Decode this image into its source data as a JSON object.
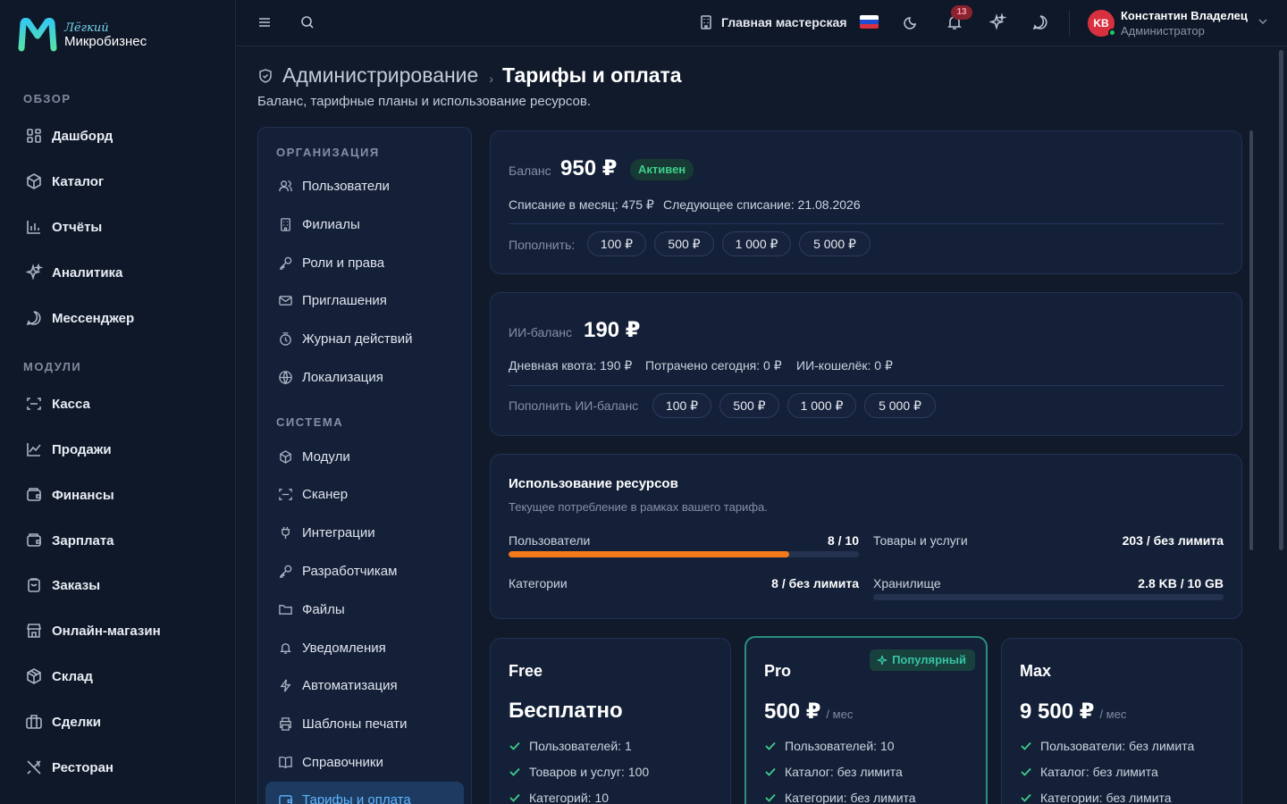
{
  "brand": {
    "small": "Лёгкий",
    "big": "Микробизнес",
    "colors": {
      "top": "#35c9f0",
      "bottom": "#56e0a8"
    }
  },
  "sidebar": {
    "sections": [
      {
        "title": "ОБЗОР",
        "items": [
          {
            "label": "Дашборд",
            "icon": "grid-icon"
          },
          {
            "label": "Каталог",
            "icon": "box-icon"
          },
          {
            "label": "Отчёты",
            "icon": "bar-chart-icon"
          },
          {
            "label": "Аналитика",
            "icon": "sparkle-icon"
          },
          {
            "label": "Мессенджер",
            "icon": "chat-icon"
          }
        ]
      },
      {
        "title": "МОДУЛИ",
        "items": [
          {
            "label": "Касса",
            "icon": "scan-icon"
          },
          {
            "label": "Продажи",
            "icon": "line-chart-icon"
          },
          {
            "label": "Финансы",
            "icon": "wallet-icon"
          },
          {
            "label": "Зарплата",
            "icon": "wallet-icon"
          },
          {
            "label": "Заказы",
            "icon": "clipboard-icon"
          },
          {
            "label": "Онлайн-магазин",
            "icon": "store-icon"
          },
          {
            "label": "Склад",
            "icon": "package-icon"
          },
          {
            "label": "Сделки",
            "icon": "briefcase-icon"
          },
          {
            "label": "Ресторан",
            "icon": "utensils-icon"
          }
        ]
      }
    ]
  },
  "header": {
    "workshop": "Главная мастерская",
    "notifications_count": "13",
    "user": {
      "initials": "KB",
      "name": "Константин Владелец",
      "role": "Администратор"
    }
  },
  "page": {
    "crumb_parent": "Администрирование",
    "crumb_separator": "›",
    "crumb_current": "Тарифы и оплата",
    "subtitle": "Баланс, тарифные планы и использование ресурсов."
  },
  "subnav": {
    "sections": [
      {
        "title": "ОРГАНИЗАЦИЯ",
        "items": [
          {
            "label": "Пользователи",
            "icon": "users-icon"
          },
          {
            "label": "Филиалы",
            "icon": "building-icon"
          },
          {
            "label": "Роли и права",
            "icon": "key-icon"
          },
          {
            "label": "Приглашения",
            "icon": "mail-icon"
          },
          {
            "label": "Журнал действий",
            "icon": "history-icon"
          },
          {
            "label": "Локализация",
            "icon": "globe-icon"
          }
        ]
      },
      {
        "title": "СИСТЕМА",
        "items": [
          {
            "label": "Модули",
            "icon": "package-icon"
          },
          {
            "label": "Сканер",
            "icon": "scan-icon"
          },
          {
            "label": "Интеграции",
            "icon": "plug-icon"
          },
          {
            "label": "Разработчикам",
            "icon": "key-icon"
          },
          {
            "label": "Файлы",
            "icon": "folder-icon"
          },
          {
            "label": "Уведомления",
            "icon": "bell-icon"
          },
          {
            "label": "Автоматизация",
            "icon": "zap-icon"
          },
          {
            "label": "Шаблоны печати",
            "icon": "printer-icon"
          },
          {
            "label": "Справочники",
            "icon": "book-icon"
          },
          {
            "label": "Тарифы и оплата",
            "icon": "wallet-icon",
            "active": true
          }
        ]
      }
    ]
  },
  "balance": {
    "label": "Баланс",
    "value": "950 ₽",
    "status": "Активен",
    "monthly": "Списание в месяц: 475 ₽",
    "next": "Следующее списание: 21.08.2026",
    "topup_label": "Пополнить:",
    "topups": [
      "100 ₽",
      "500 ₽",
      "1 000 ₽",
      "5 000 ₽"
    ]
  },
  "ai_balance": {
    "label": "ИИ-баланс",
    "value": "190 ₽",
    "quota": "Дневная квота: 190 ₽",
    "spent": "Потрачено сегодня: 0 ₽",
    "wallet": "ИИ-кошелёк: 0 ₽",
    "topup_label": "Пополнить ИИ-баланс",
    "topups": [
      "100 ₽",
      "500 ₽",
      "1 000 ₽",
      "5 000 ₽"
    ]
  },
  "resources": {
    "title": "Использование ресурсов",
    "subtitle": "Текущее потребление в рамках вашего тарифа.",
    "items": [
      {
        "label": "Пользователи",
        "value": "8 / 10",
        "fill": 0.8,
        "bar": true
      },
      {
        "label": "Товары и услуги",
        "value": "203 / без лимита",
        "bar": false
      },
      {
        "label": "Категории",
        "value": "8 / без лимита",
        "bar": false
      },
      {
        "label": "Хранилище",
        "value": "2.8 KB / 10 GB",
        "fill": 0.0,
        "bar": true
      }
    ]
  },
  "plans": [
    {
      "name": "Free",
      "price": "Бесплатно",
      "unit": "",
      "popular": false,
      "features": [
        "Пользователей: 1",
        "Товаров и услуг: 100",
        "Категорий: 10"
      ]
    },
    {
      "name": "Pro",
      "price": "500 ₽",
      "unit": "/ мес",
      "popular": true,
      "badge": "Популярный",
      "features": [
        "Пользователей: 10",
        "Каталог: без лимита",
        "Категории: без лимита"
      ]
    },
    {
      "name": "Max",
      "price": "9 500 ₽",
      "unit": "/ мес",
      "popular": false,
      "features": [
        "Пользователи: без лимита",
        "Каталог: без лимита",
        "Категории: без лимита"
      ]
    }
  ]
}
